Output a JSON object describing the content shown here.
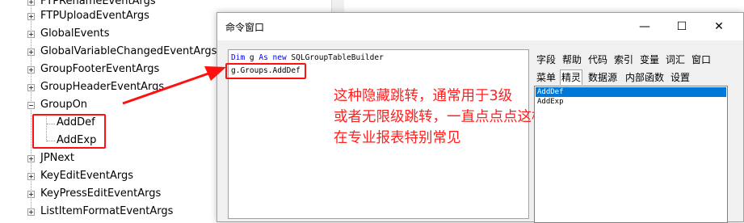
{
  "tree": {
    "items": [
      {
        "label": "FTPRenameEventArgs"
      },
      {
        "label": "FTPUploadEventArgs"
      },
      {
        "label": "GlobalEvents"
      },
      {
        "label": "GlobalVariableChangedEventArgs"
      },
      {
        "label": "GroupFooterEventArgs"
      },
      {
        "label": "GroupHeaderEventArgs"
      },
      {
        "label": "GroupOn",
        "expanded": true,
        "children": [
          {
            "label": "AddDef"
          },
          {
            "label": "AddExp"
          }
        ]
      },
      {
        "label": "JPNext"
      },
      {
        "label": "KeyEditEventArgs"
      },
      {
        "label": "KeyPressEditEventArgs"
      },
      {
        "label": "ListItemFormatEventArgs"
      }
    ]
  },
  "window": {
    "title": "命令窗口",
    "minimize_glyph": "—",
    "maximize_glyph": "☐",
    "close_glyph": "✕"
  },
  "editor": {
    "line1": {
      "kw1": "Dim",
      "id": " g ",
      "kw2": "As",
      "kw3": " new",
      "rest": " SQLGroupTableBuilder"
    },
    "line2": "g.Groups.AddDef"
  },
  "annotation": {
    "lines": [
      "这种隐藏跳转，通常用于3级",
      "或者无限级跳转，一直点点点这样调用下级",
      "在专业报表特别常见"
    ],
    "color": "#ff2020"
  },
  "right_panel": {
    "tabs_row1": [
      "字段",
      "帮助",
      "代码",
      "索引",
      "变量",
      "词汇",
      "窗口"
    ],
    "tabs_row2": [
      "菜单",
      "精灵",
      "数据源",
      "内部函数",
      "设置"
    ],
    "active_tab": "精灵",
    "list": [
      {
        "label": "AddDef",
        "selected": true
      },
      {
        "label": "AddExp",
        "selected": false
      }
    ]
  },
  "colors": {
    "accent_red": "#ff1010",
    "selection": "#0078d7",
    "keyword": "#0000ff"
  }
}
